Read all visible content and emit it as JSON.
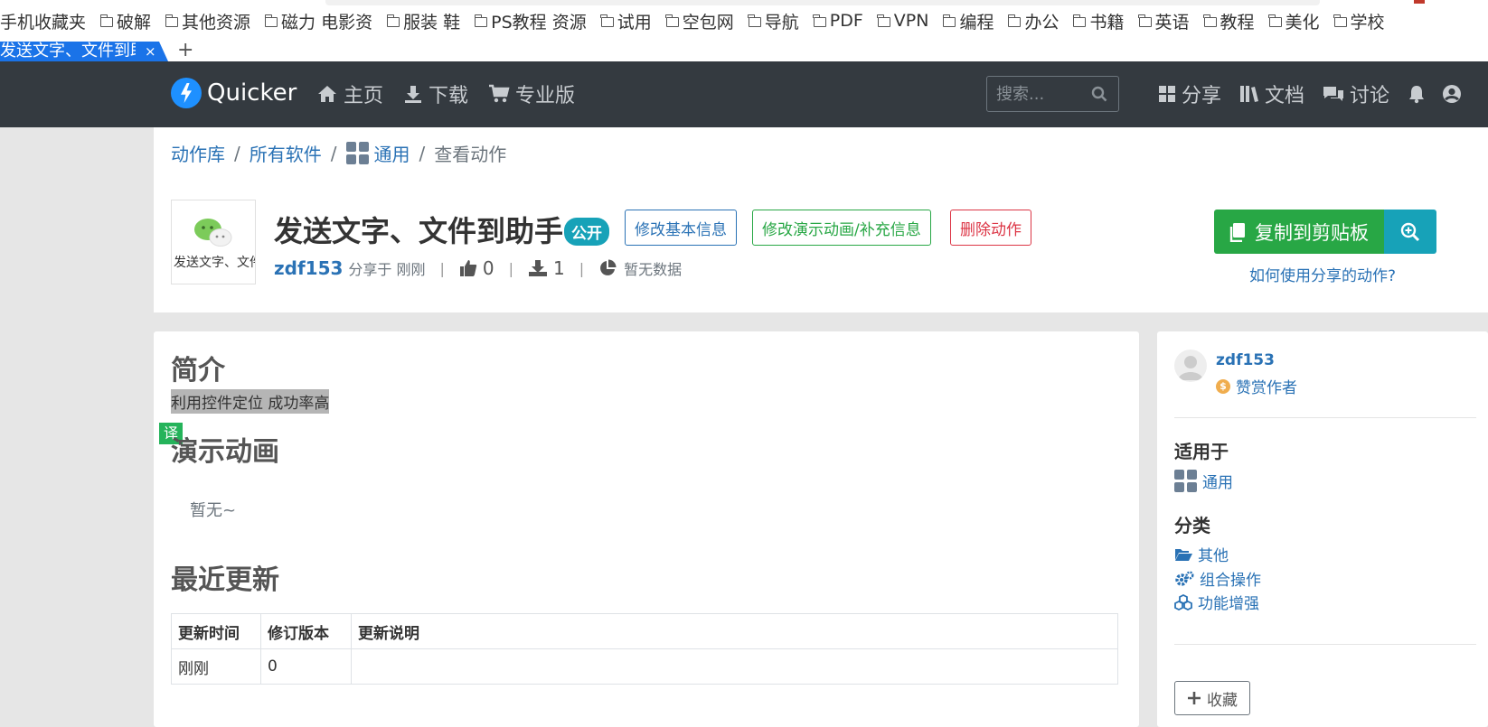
{
  "bookmarks": [
    "手机收藏夹",
    "破解",
    "其他资源",
    "磁力 电影资",
    "服装  鞋",
    "PS教程 资源",
    "试用",
    "空包网",
    "导航",
    "PDF",
    "VPN",
    "编程",
    "办公",
    "书籍",
    "英语",
    "教程",
    "美化",
    "学校"
  ],
  "tab": {
    "title": "发送文字、文件到助手",
    "close": "×",
    "new": "+"
  },
  "nav": {
    "brand": "Quicker",
    "home": "主页",
    "download": "下载",
    "pro": "专业版",
    "search_placeholder": "搜索...",
    "share": "分享",
    "docs": "文档",
    "discuss": "讨论"
  },
  "breadcrumb": {
    "library": "动作库",
    "all_software": "所有软件",
    "general": "通用",
    "current": "查看动作",
    "sep": "/"
  },
  "action": {
    "icon_caption": "发送文字、文件到助手",
    "title": "发送文字、文件到助手",
    "badge": "公开",
    "edit_basic": "修改基本信息",
    "edit_demo": "修改演示动画/补充信息",
    "delete": "删除动作",
    "author": "zdf153",
    "shared": "分享于 刚刚",
    "likes": "0",
    "downloads": "1",
    "stats": "暂无数据",
    "copy_button": "复制到剪贴板",
    "howto": "如何使用分享的动作?"
  },
  "main": {
    "intro_title": "简介",
    "intro_text": "利用控件定位 成功率高",
    "translate": "译",
    "demo_title": "演示动画",
    "demo_empty": "暂无~",
    "updates_title": "最近更新",
    "columns": [
      "更新时间",
      "修订版本",
      "更新说明"
    ],
    "rows": [
      [
        "刚刚",
        "0",
        ""
      ]
    ]
  },
  "sidebar": {
    "author": "zdf153",
    "reward": "赞赏作者",
    "applies_title": "适用于",
    "applies_item": "通用",
    "category_title": "分类",
    "categories": [
      "其他",
      "组合操作",
      "功能增强"
    ],
    "favorite": "收藏"
  },
  "colors": {
    "navbar": "#343a40",
    "link": "#2a72b5",
    "green": "#28a745",
    "teal": "#17a2b8",
    "red": "#dc3545"
  }
}
